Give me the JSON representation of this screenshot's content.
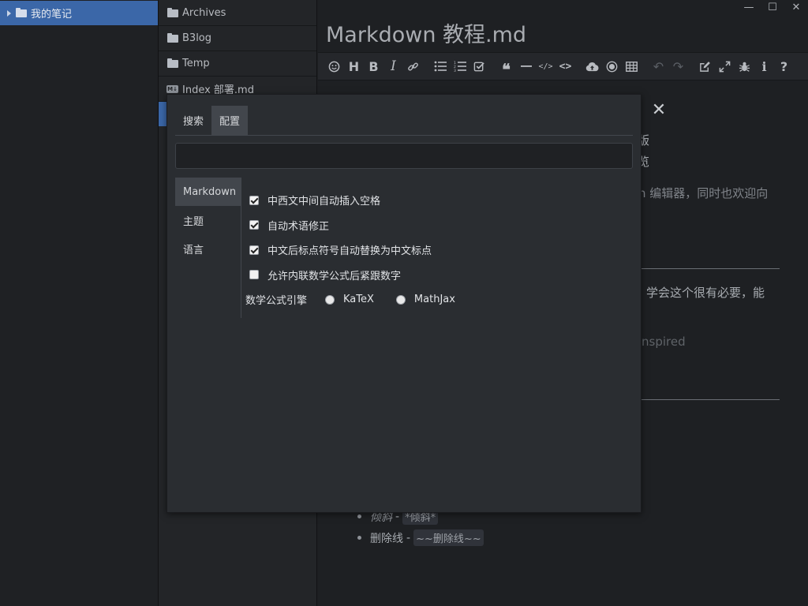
{
  "tree": {
    "root_label": "我的笔记"
  },
  "files": [
    {
      "label": "Archives",
      "type": "folder"
    },
    {
      "label": "B3log",
      "type": "folder"
    },
    {
      "label": "Temp",
      "type": "folder"
    },
    {
      "label": "Index 部署.md",
      "type": "markdown"
    }
  ],
  "editor": {
    "title": "Markdown 教程.md",
    "window_controls": {
      "minimize": "—",
      "maximize": "☐",
      "close": "✕"
    },
    "visible_text": {
      "line_1": "版",
      "line_2": "览",
      "line_3": "n 编辑器，同时也欢迎向",
      "line_4": "学会这个很有必要，能",
      "line_5": "nspired"
    },
    "bullets": [
      {
        "label": "倾斜",
        "code": "*倾斜*"
      },
      {
        "label": "删除线",
        "code": "~~删除线~~"
      }
    ]
  },
  "toolbar": {
    "icons": [
      "emoji-icon",
      "heading-icon",
      "bold-icon",
      "italic-icon",
      "link-icon",
      "bullet-list-icon",
      "ordered-list-icon",
      "check-list-icon",
      "quote-icon",
      "line-icon",
      "inline-code-icon",
      "code-block-icon",
      "upload-icon",
      "record-icon",
      "table-icon",
      "undo-icon",
      "redo-icon",
      "edit-mode-icon",
      "fullscreen-icon",
      "debug-icon",
      "info-icon",
      "help-icon"
    ]
  },
  "dialog": {
    "close_glyph": "✕",
    "tabs": [
      {
        "label": "搜索",
        "active": false
      },
      {
        "label": "配置",
        "active": true
      }
    ],
    "search": {
      "value": "",
      "placeholder": ""
    },
    "side_tabs": [
      {
        "label": "Markdown",
        "active": true
      },
      {
        "label": "主题",
        "active": false
      },
      {
        "label": "语言",
        "active": false
      }
    ],
    "options": [
      {
        "label": "中西文中间自动插入空格",
        "checked": true
      },
      {
        "label": "自动术语修正",
        "checked": true
      },
      {
        "label": "中文后标点符号自动替换为中文标点",
        "checked": true
      },
      {
        "label": "允许内联数学公式后紧跟数字",
        "checked": false
      }
    ],
    "math_engine": {
      "label": "数学公式引擎",
      "choices": [
        "KaTeX",
        "MathJax"
      ]
    }
  },
  "colors": {
    "accent": "#3b67a8",
    "dialog_bg": "#2a2d31",
    "editor_bg": "#1e2023"
  }
}
